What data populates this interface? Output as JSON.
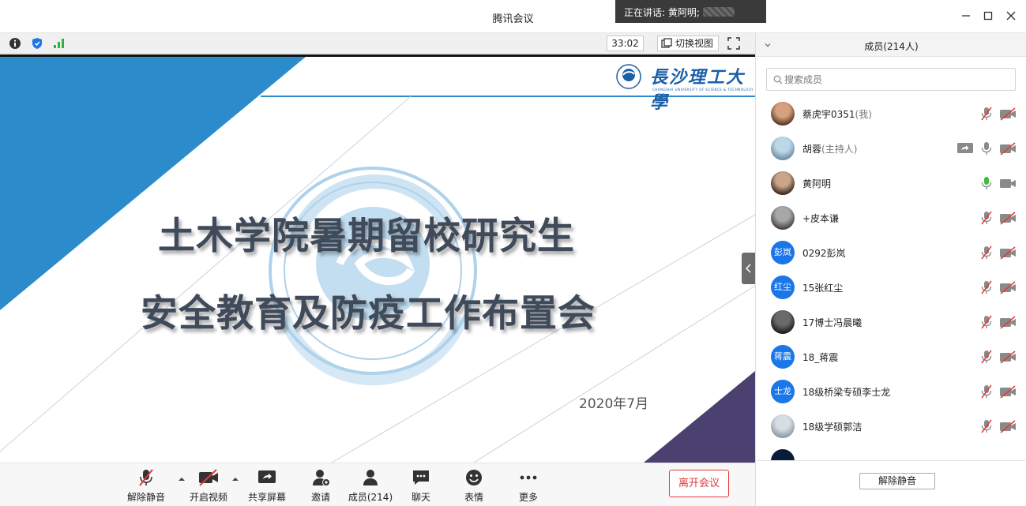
{
  "window": {
    "title": "腾讯会议",
    "speaking_label": "正在讲话: 黄阿明;"
  },
  "video_toolbar": {
    "timer": "33:02",
    "switch_view": "切换视图"
  },
  "slide": {
    "title_line1": "土木学院暑期留校研究生",
    "title_line2": "安全教育及防疫工作布置会",
    "date": "2020年7月",
    "logo_text": "長沙理工大學",
    "logo_sub": "CHANGSHA UNIVERSITY OF SCIENCE & TECHNOLOGY",
    "watermark_text": "UNIVERSITY OF SCIENCE & TECHNOLOGY",
    "watermark_left": "CHANG",
    "colors": {
      "blue": "#2c8ccb",
      "purple": "#4b4170",
      "title": "#3f4a5a"
    }
  },
  "toolbar": {
    "unmute": "解除静音",
    "start_video": "开启视频",
    "share_screen": "共享屏幕",
    "invite": "邀请",
    "members": "成员(214)",
    "chat": "聊天",
    "reactions": "表情",
    "more": "更多",
    "leave": "离开会议"
  },
  "panel": {
    "title": "成员(214人)",
    "search_placeholder": "搜索成员",
    "unmute_button": "解除静音",
    "members": [
      {
        "name": "蔡虎宇0351",
        "role": "(我)",
        "avatar": "photo",
        "mic": "muted",
        "video": "off"
      },
      {
        "name": "胡蓉",
        "role": "(主持人)",
        "avatar": "photo",
        "mic": "on",
        "video": "off",
        "sharing": true
      },
      {
        "name": "黄阿明",
        "role": "",
        "avatar": "photo",
        "mic": "speaking",
        "video": "on"
      },
      {
        "name": "+皮本谦",
        "role": "",
        "avatar": "photo",
        "mic": "muted",
        "video": "off"
      },
      {
        "name": "0292彭岚",
        "role": "",
        "avatar_text": "彭岚",
        "mic": "muted",
        "video": "off"
      },
      {
        "name": "15张红尘",
        "role": "",
        "avatar_text": "红尘",
        "mic": "muted",
        "video": "off"
      },
      {
        "name": "17博士冯晨曦",
        "role": "",
        "avatar": "photo",
        "mic": "muted",
        "video": "off"
      },
      {
        "name": "18_蒋震",
        "role": "",
        "avatar_text": "蒋震",
        "mic": "muted",
        "video": "off"
      },
      {
        "name": "18级桥梁专硕李士龙",
        "role": "",
        "avatar_text": "士龙",
        "mic": "muted",
        "video": "off"
      },
      {
        "name": "18级学硕郭洁",
        "role": "",
        "avatar": "photo",
        "mic": "muted",
        "video": "off"
      }
    ]
  },
  "colors": {
    "accent": "#1b76e8",
    "danger": "#e33a3a",
    "speaking": "#3cc03c"
  }
}
